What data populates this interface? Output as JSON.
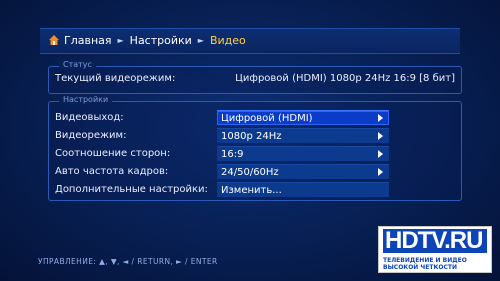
{
  "breadcrumb": {
    "home": "Главная",
    "settings": "Настройки",
    "current": "Видео"
  },
  "status": {
    "title": "Статус",
    "label": "Текущий видеорежим:",
    "value": "Цифровой (HDMI) 1080p 24Hz 16:9 [8 бит]"
  },
  "settings": {
    "title": "Настройки",
    "items": [
      {
        "label": "Видеовыход:",
        "value": "Цифровой (HDMI)"
      },
      {
        "label": "Видеорежим:",
        "value": "1080p 24Hz"
      },
      {
        "label": "Соотношение сторон:",
        "value": "16:9"
      },
      {
        "label": "Авто частота кадров:",
        "value": "24/50/60Hz"
      },
      {
        "label": "Дополнительные настройки:",
        "value": "Изменить..."
      }
    ]
  },
  "controls_hint": "УПРАВЛЕНИЕ: ▲, ▼, ◄ / RETURN, ► / ENTER",
  "logo": {
    "main": "HDTV.RU",
    "sub": "ТЕЛЕВИДЕНИЕ И ВИДЕО ВЫСОКОЙ ЧЕТКОСТИ"
  },
  "colors": {
    "background": "#082258",
    "selection": "#0a3cc8",
    "crumb_current": "#ffd43a"
  },
  "icons": [
    "home-icon",
    "chevron-right-icon"
  ]
}
